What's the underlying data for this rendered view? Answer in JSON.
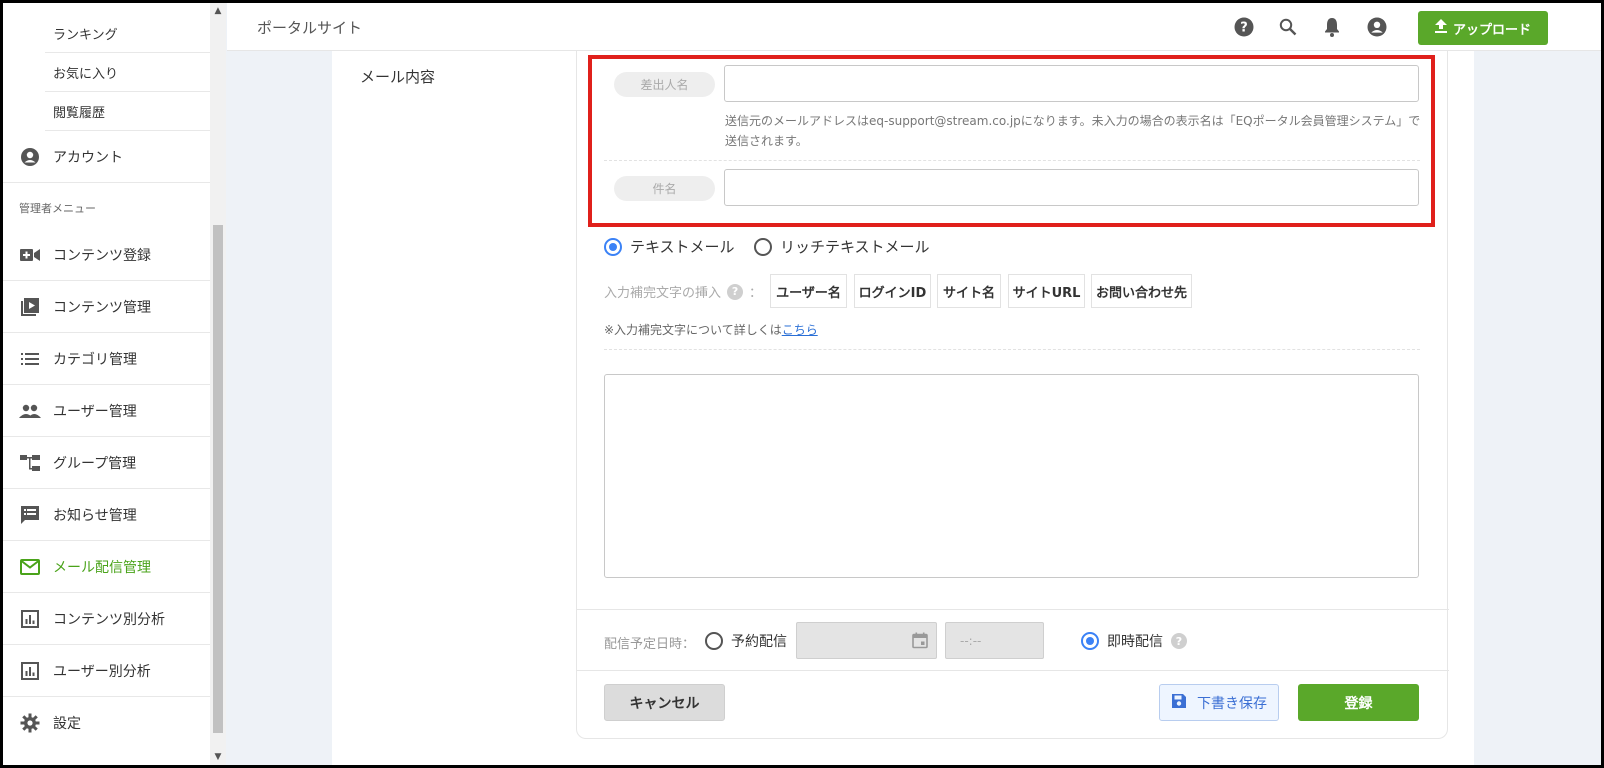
{
  "header": {
    "site_name": "ポータルサイト",
    "upload_label": "アップロード"
  },
  "sidebar": {
    "sub_items": [
      "ランキング",
      "お気に入り",
      "閲覧履歴"
    ],
    "account_label": "アカウント",
    "admin_section": "管理者メニュー",
    "admin_items": [
      {
        "label": "コンテンツ登録",
        "icon": "video-add-icon"
      },
      {
        "label": "コンテンツ管理",
        "icon": "playlist-icon"
      },
      {
        "label": "カテゴリ管理",
        "icon": "list-icon"
      },
      {
        "label": "ユーザー管理",
        "icon": "users-icon"
      },
      {
        "label": "グループ管理",
        "icon": "hierarchy-icon"
      },
      {
        "label": "お知らせ管理",
        "icon": "notice-icon"
      },
      {
        "label": "メール配信管理",
        "icon": "mail-icon"
      },
      {
        "label": "コンテンツ別分析",
        "icon": "chart-icon"
      },
      {
        "label": "ユーザー別分析",
        "icon": "chart-icon"
      },
      {
        "label": "設定",
        "icon": "gear-icon"
      }
    ],
    "active_item": "メール配信管理",
    "accent_color": "#4aa31a"
  },
  "form": {
    "section_label": "メール内容",
    "sender_label": "差出人名",
    "sender_value": "",
    "sender_help_line1": "送信元のメールアドレスはeq-support@stream.co.jpになります。未入力の場合の表示名は「EQポータル会員管理システム」で",
    "sender_help_line2": "送信されます。",
    "subject_label": "件名",
    "subject_value": "",
    "mail_type_text": "テキストメール",
    "mail_type_rich": "リッチテキストメール",
    "mail_type_selected": "テキストメール",
    "insert_label": "入力補完文字の挿入",
    "insert_chips": [
      "ユーザー名",
      "ログインID",
      "サイト名",
      "サイトURL",
      "お問い合わせ先"
    ],
    "note_prefix": "※入力補完文字について詳しくは",
    "note_link": "こちら",
    "body_value": ""
  },
  "schedule": {
    "label": "配信予定日時：",
    "reserved_label": "予約配信",
    "time_placeholder": "--:--",
    "instant_label": "即時配信",
    "selected": "即時配信"
  },
  "actions": {
    "cancel": "キャンセル",
    "draft": "下書き保存",
    "submit": "登録"
  },
  "colors": {
    "primary_green": "#5aa82a",
    "highlight_red": "#e0201b",
    "radio_blue": "#3b82f6"
  }
}
